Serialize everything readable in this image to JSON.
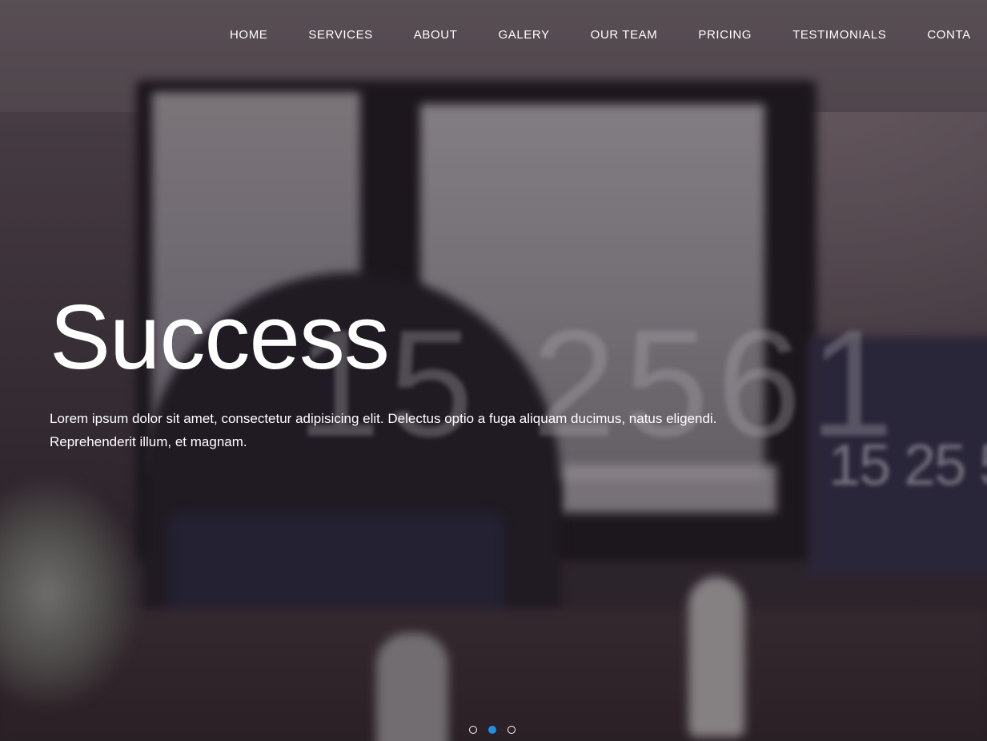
{
  "nav": {
    "items": [
      {
        "label": "HOME"
      },
      {
        "label": "SERVICES"
      },
      {
        "label": "ABOUT"
      },
      {
        "label": "GALERY"
      },
      {
        "label": "OUR TEAM"
      },
      {
        "label": "PRICING"
      },
      {
        "label": "TESTIMONIALS"
      },
      {
        "label": "CONTA"
      }
    ]
  },
  "hero": {
    "title": "Success",
    "text": "Lorem ipsum dolor sit amet, consectetur adipisicing elit. Delectus optio a fuga aliquam ducimus, natus eligendi. Reprehenderit illum, et magnam.",
    "background_digits": "15 2561",
    "laptop_digits": "15 25 5"
  },
  "slider": {
    "slide_count": 3,
    "active_index": 1
  },
  "colors": {
    "accent": "#1e90e6",
    "text": "#ffffff"
  }
}
